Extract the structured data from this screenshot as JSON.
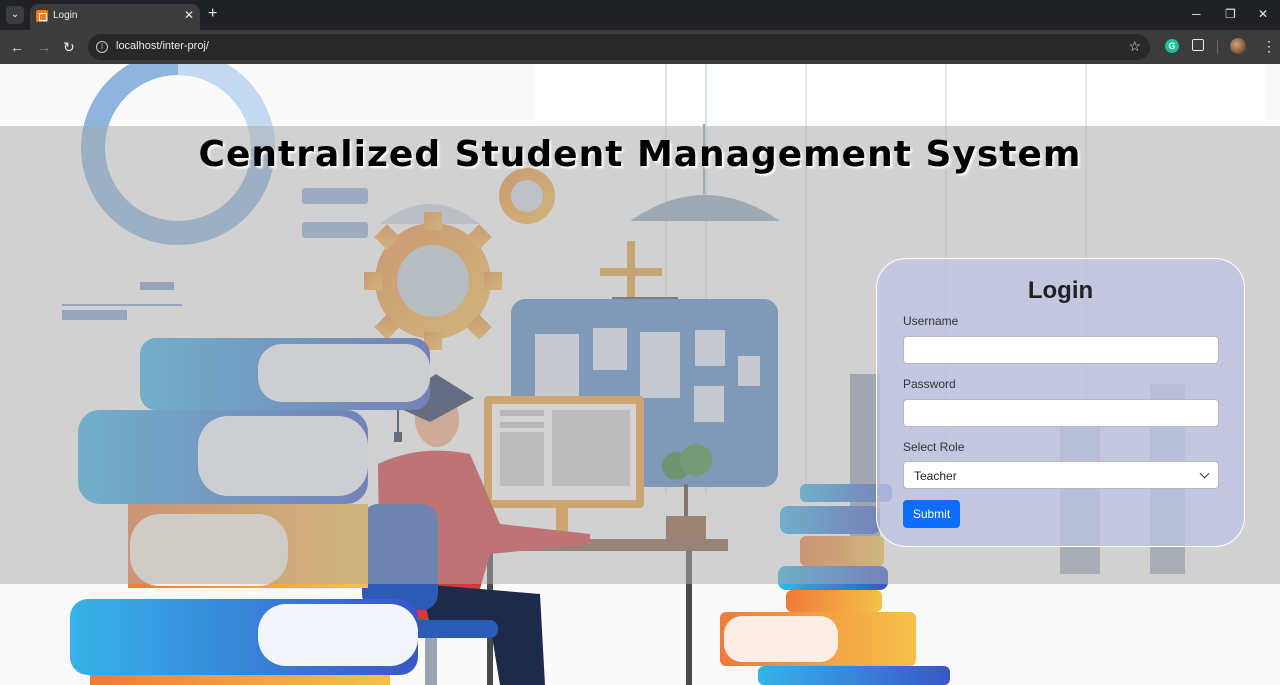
{
  "browser": {
    "tab": {
      "title": "Login"
    },
    "url": "localhost/inter-proj/"
  },
  "page": {
    "title": "Centralized Student Management System"
  },
  "login": {
    "title": "Login",
    "username_label": "Username",
    "username_value": "",
    "password_label": "Password",
    "password_value": "",
    "role_label": "Select Role",
    "role_selected": "Teacher",
    "submit_label": "Submit"
  },
  "colors": {
    "accent": "#0d6efd",
    "overlay": "#aaaaaa",
    "card": "#bec3e6"
  }
}
